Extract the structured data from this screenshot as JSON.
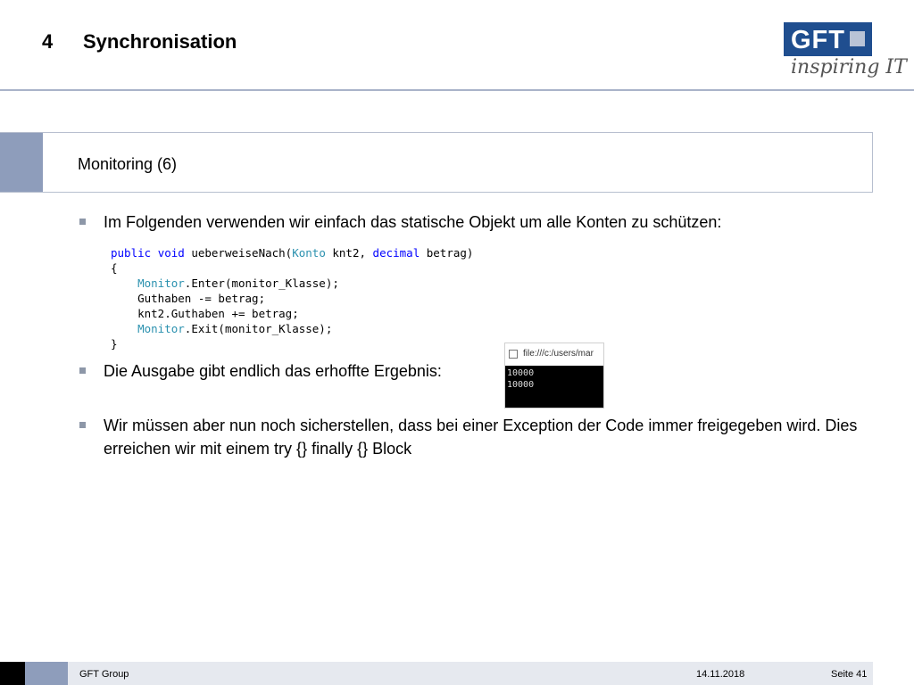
{
  "slide": {
    "section_number": "4",
    "title": "Synchronisation",
    "subheader": "Monitoring (6)"
  },
  "logo": {
    "brand": "GFT",
    "tagline": "inspiring IT",
    "brand_color": "#1f4e8f"
  },
  "bullets": [
    {
      "text": "Im Folgenden verwenden wir einfach das statische Objekt um alle Konten zu schützen:"
    },
    {
      "text": "Die Ausgabe gibt endlich das erhoffte Ergebnis:"
    },
    {
      "text": "Wir müssen aber nun noch sicherstellen, dass bei einer Exception der Code immer freigegeben wird. Dies erreichen wir mit einem try {} finally {} Block"
    }
  ],
  "code": {
    "l1_kw1": "public",
    "l1_kw2": "void",
    "l1_name": "ueberweiseNach(",
    "l1_type": "Konto",
    "l1_param1": " knt2, ",
    "l1_kw3": "decimal",
    "l1_param2": " betrag)",
    "l2": "{",
    "l3_type": "Monitor",
    "l3_rest": ".Enter(monitor_Klasse);",
    "l4": "Guthaben -= betrag;",
    "l5": "knt2.Guthaben += betrag;",
    "l6_type": "Monitor",
    "l6_rest": ".Exit(monitor_Klasse);",
    "l7": "}"
  },
  "console": {
    "url": "file:///c:/users/mar",
    "lines": [
      "10000",
      "10000"
    ]
  },
  "footer": {
    "company": "GFT Group",
    "date": "14.11.2018",
    "page": "Seite 41"
  },
  "colors": {
    "accent": "#8e9dbb",
    "keyword": "#0000ff",
    "type": "#2b91af"
  }
}
